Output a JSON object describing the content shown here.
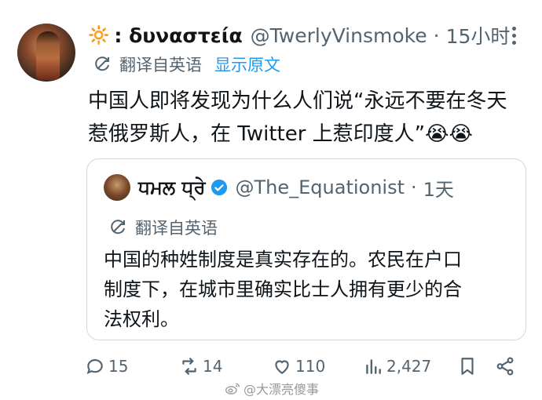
{
  "tweet": {
    "emoji": "🔆",
    "display_name": ": δυναστεία",
    "handle": "@TwerlyVinsmoke",
    "separator": "·",
    "time": "15小时",
    "translate_label": "翻译自英语",
    "show_original": "显示原文",
    "text_lines": [
      "中国人即将发现为什么人们说“永远不要在冬天",
      "惹俄罗斯人，在 Twitter 上惹印度人”😭😭"
    ]
  },
  "quote": {
    "display_name": "ਧਮਲ ਧ੍ਰੇ",
    "handle": "@The_Equationist",
    "separator": "·",
    "time": "1天",
    "translate_label": "翻译自英语",
    "text_lines": [
      "中国的种姓制度是真实存在的。农民在户口",
      "制度下，在城市里确实比士人拥有更少的合",
      "法权利。"
    ]
  },
  "actions": {
    "reply_count": "15",
    "retweet_count": "14",
    "like_count": "110",
    "view_count": "2,427"
  },
  "watermark": "@大漂亮傻事",
  "icons": {
    "more": "more-vertical-icon",
    "translate": "translate-icon",
    "verified": "verified-badge-icon",
    "reply": "reply-icon",
    "retweet": "retweet-icon",
    "like": "heart-icon",
    "views": "views-icon",
    "bookmark": "bookmark-icon",
    "share": "share-icon"
  },
  "colors": {
    "accent": "#1d9bf0",
    "secondary_text": "#536471",
    "primary_text": "#0f1419",
    "border": "#cfd9de"
  }
}
